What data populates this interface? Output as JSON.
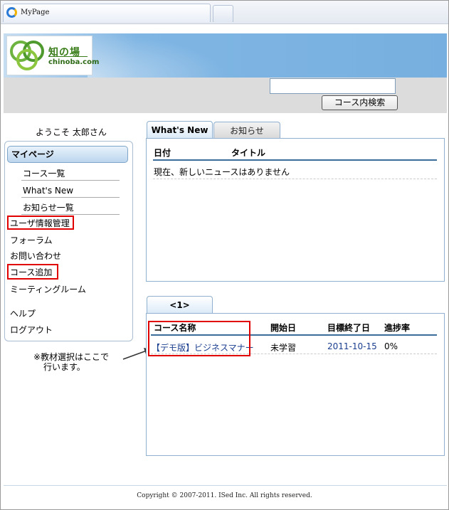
{
  "browser": {
    "tab_title": "MyPage"
  },
  "header": {
    "logo_main": "知の場",
    "logo_sub": "chinoba.com",
    "search_placeholder": "",
    "search_button": "コース内検索"
  },
  "sidebar": {
    "welcome": "ようこそ 太郎さん",
    "section_title": "マイページ",
    "sub_items": [
      "コース一覧",
      "What's New",
      "お知らせ一覧"
    ],
    "items": [
      "ユーザ情報管理",
      "フォーラム",
      "お問い合わせ",
      "コース追加",
      "ミーティングルーム",
      "ヘルプ",
      "ログアウト"
    ]
  },
  "annotation": {
    "note_line1": "※教材選択はここで",
    "note_line2": "行います。"
  },
  "news_panel": {
    "tabs": [
      "What's New",
      "お知らせ"
    ],
    "columns": [
      "日付",
      "タイトル"
    ],
    "empty_message": "現在、新しいニュースはありません"
  },
  "course_panel": {
    "tab": "<1>",
    "columns": [
      "コース名称",
      "開始日",
      "目標終了日",
      "進捗率"
    ],
    "rows": [
      {
        "name": "【デモ版】ビジネスマナー",
        "start": "未学習",
        "target_end": "2011-10-15",
        "progress": "0%"
      }
    ]
  },
  "footer": {
    "copyright": "Copyright © 2007-2011. ISed Inc. All rights reserved."
  },
  "colors": {
    "highlight_box": "#e00000",
    "link": "#1a3e8f",
    "banner": "#77b0e0"
  }
}
